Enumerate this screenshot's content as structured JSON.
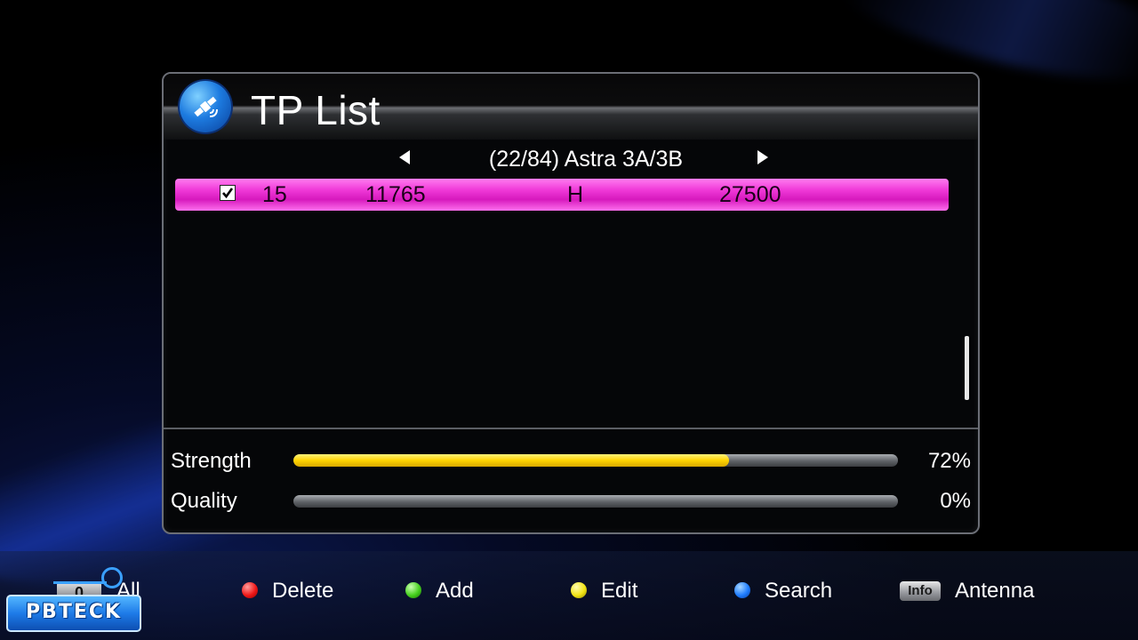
{
  "header": {
    "title": "TP List",
    "icon": "satellite-icon"
  },
  "satellite_nav": {
    "label": "(22/84) Astra 3A/3B"
  },
  "tp_list": [
    {
      "checked": true,
      "number": "15",
      "frequency": "11765",
      "polarization": "H",
      "symbol_rate": "27500"
    }
  ],
  "meters": {
    "strength": {
      "label": "Strength",
      "value_text": "72%",
      "percent": 72
    },
    "quality": {
      "label": "Quality",
      "value_text": "0%",
      "percent": 0
    }
  },
  "footer": {
    "zero_key": "0",
    "all_label": "All",
    "delete_label": "Delete",
    "add_label": "Add",
    "edit_label": "Edit",
    "search_label": "Search",
    "info_key": "Info",
    "antenna_label": "Antenna"
  },
  "logo": {
    "text": "PBTECK"
  },
  "colors": {
    "highlight_row": "#f03ad8",
    "strength_fill": "#ffd400",
    "red_key": "#f01818",
    "green_key": "#45d01e",
    "yellow_key": "#f2e414",
    "blue_key": "#1f7dff"
  }
}
